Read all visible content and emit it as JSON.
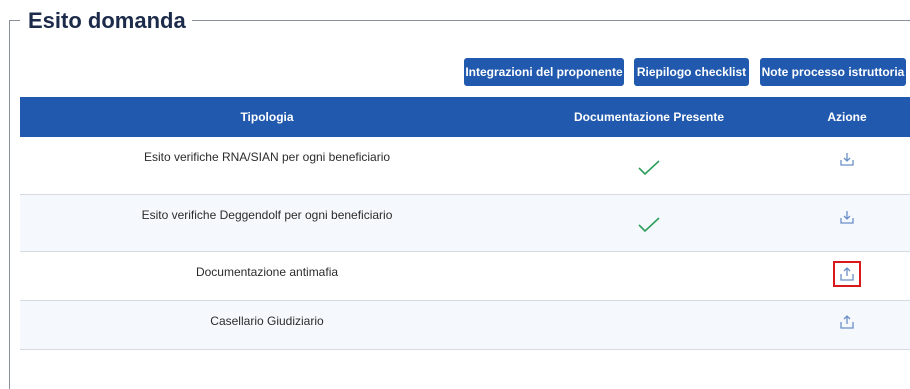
{
  "section": {
    "title": "Esito domanda"
  },
  "toolbar": {
    "integrazioni_label": "Integrazioni del proponente",
    "riepilogo_label": "Riepilogo checklist",
    "note_label": "Note processo istruttoria"
  },
  "table": {
    "headers": [
      "Tipologia",
      "Documentazione Presente",
      "Azione"
    ],
    "rows": [
      {
        "tipologia": "Esito verifiche RNA/SIAN per ogni beneficiario",
        "documentazione_presente": true,
        "azione_icon": "download-icon"
      },
      {
        "tipologia": "Esito verifiche Deggendolf per ogni beneficiario",
        "documentazione_presente": true,
        "azione_icon": "download-icon"
      },
      {
        "tipologia": "Documentazione antimafia",
        "documentazione_presente": false,
        "azione_icon": "upload-icon",
        "highlighted": true
      },
      {
        "tipologia": "Casellario Giudiziario",
        "documentazione_presente": false,
        "azione_icon": "upload-icon"
      }
    ]
  },
  "colors": {
    "primary": "#2059ae",
    "check": "#2e9e5b",
    "icon": "#6b8fc7",
    "highlight": "#d7191c",
    "title": "#1c2b4a"
  }
}
